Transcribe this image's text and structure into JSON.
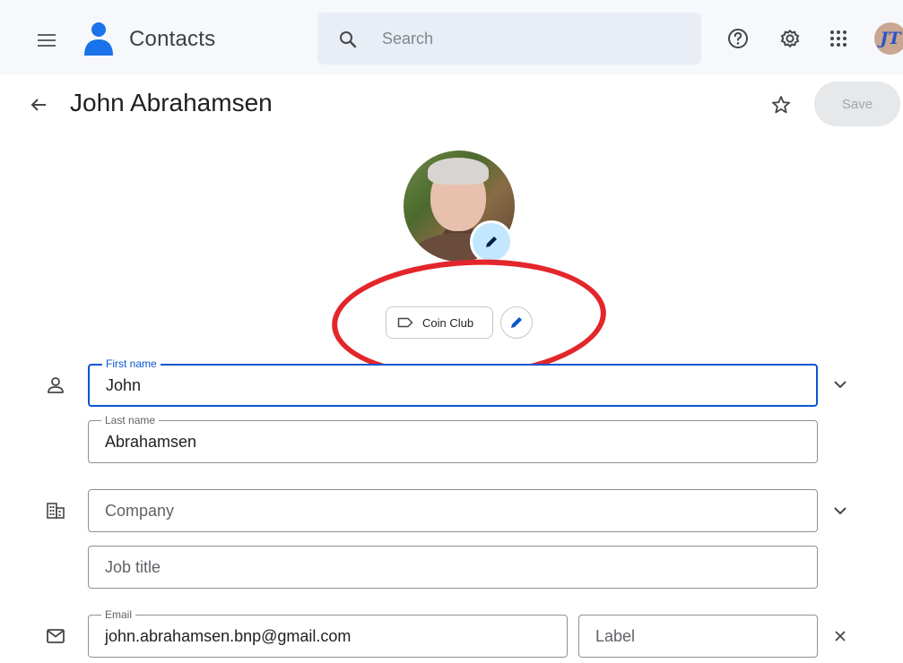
{
  "topbar": {
    "app_title": "Contacts",
    "search_placeholder": "Search",
    "account_initials": "JT",
    "icons": [
      "menu-icon",
      "contacts-logo-icon",
      "search-icon",
      "help-icon",
      "settings-icon",
      "apps-grid-icon"
    ]
  },
  "header": {
    "contact_name": "John Abrahamsen",
    "save_label": "Save",
    "icons": [
      "back-arrow-icon",
      "star-icon"
    ]
  },
  "labels": {
    "chip_label": "Coin Club",
    "icons": [
      "label-tag-icon",
      "pencil-icon"
    ]
  },
  "form": {
    "first_name": {
      "label": "First name",
      "value": "John"
    },
    "last_name": {
      "label": "Last name",
      "value": "Abrahamsen"
    },
    "company": {
      "placeholder": "Company"
    },
    "job_title": {
      "placeholder": "Job title"
    },
    "email": {
      "label": "Email",
      "value": "john.abrahamsen.bnp@gmail.com"
    },
    "email_label": {
      "placeholder": "Label"
    },
    "icons": [
      "person-icon",
      "building-icon",
      "mail-icon",
      "chevron-down-icon",
      "close-icon"
    ]
  },
  "colors": {
    "topbar_bg": "#f6f8fc",
    "search_bg": "#e9eef6",
    "accent": "#0b57d0",
    "edit_badge": "#c2e7ff",
    "annotation": "#e3262b"
  }
}
